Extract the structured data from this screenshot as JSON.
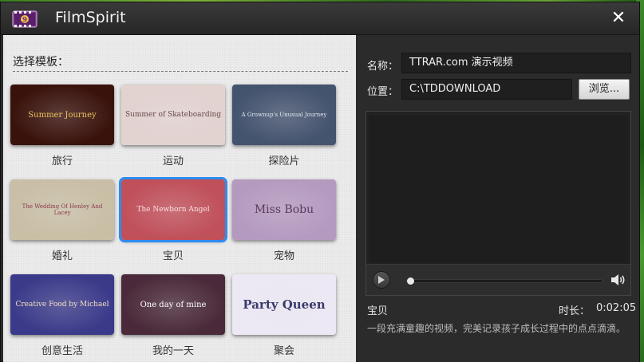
{
  "window": {
    "title": "FilmSpirit",
    "close_glyph": "✕"
  },
  "left_panel": {
    "section_label": "选择模板：",
    "templates": [
      {
        "thumb_text": "Summer Journey",
        "label": "旅行",
        "bg": "#3a120c",
        "text_color": "#e8c35a",
        "selected": false
      },
      {
        "thumb_text": "Summer of Skateboarding",
        "label": "运动",
        "bg": "#e2d2d0",
        "text_color": "#6a4a4a",
        "selected": false
      },
      {
        "thumb_text": "A Grownup's Unusual Journey",
        "label": "探险片",
        "bg": "#44536e",
        "text_color": "#dfe6f2",
        "selected": false
      },
      {
        "thumb_text": "The Wedding Of Henley And Lacey",
        "label": "婚礼",
        "bg": "#c9bfa6",
        "text_color": "#8a3a4a",
        "selected": false
      },
      {
        "thumb_text": "The Newborn Angel",
        "label": "宝贝",
        "bg": "#c0505a",
        "text_color": "#fbe0e0",
        "selected": true
      },
      {
        "thumb_text": "Miss Bobu",
        "label": "宠物",
        "bg": "#b59ac0",
        "text_color": "#5a3a5e",
        "selected": false
      },
      {
        "thumb_text": "Creative Food by Michael",
        "label": "创意生活",
        "bg": "#3b3a8a",
        "text_color": "#f0e0c0",
        "selected": false
      },
      {
        "thumb_text": "One day of mine",
        "label": "我的一天",
        "bg": "#4a2a3a",
        "text_color": "#ffffff",
        "selected": false
      },
      {
        "thumb_text": "Party Queen",
        "label": "聚会",
        "bg": "#ece8f4",
        "text_color": "#3a3a6a",
        "selected": false
      }
    ]
  },
  "right_panel": {
    "name_label": "名称：",
    "name_value": "TTRAR.com 演示视频",
    "location_label": "位置：",
    "location_value": "C:\\TDDOWNLOAD",
    "browse_label": "浏览...",
    "player": {
      "progress": 0.0
    },
    "info_title": "宝贝",
    "duration_label": "时长：",
    "duration_value": "0:02:05",
    "description": "一段充满童趣的视频，完美记录孩子成长过程中的点点滴滴。"
  },
  "colors": {
    "accent": "#2d8cf0",
    "panel_dark": "#2b2b2b",
    "panel_light": "#ececec"
  },
  "icons": {
    "app": "film-clapper-icon",
    "close": "close-icon",
    "play": "play-icon",
    "volume": "volume-icon"
  }
}
